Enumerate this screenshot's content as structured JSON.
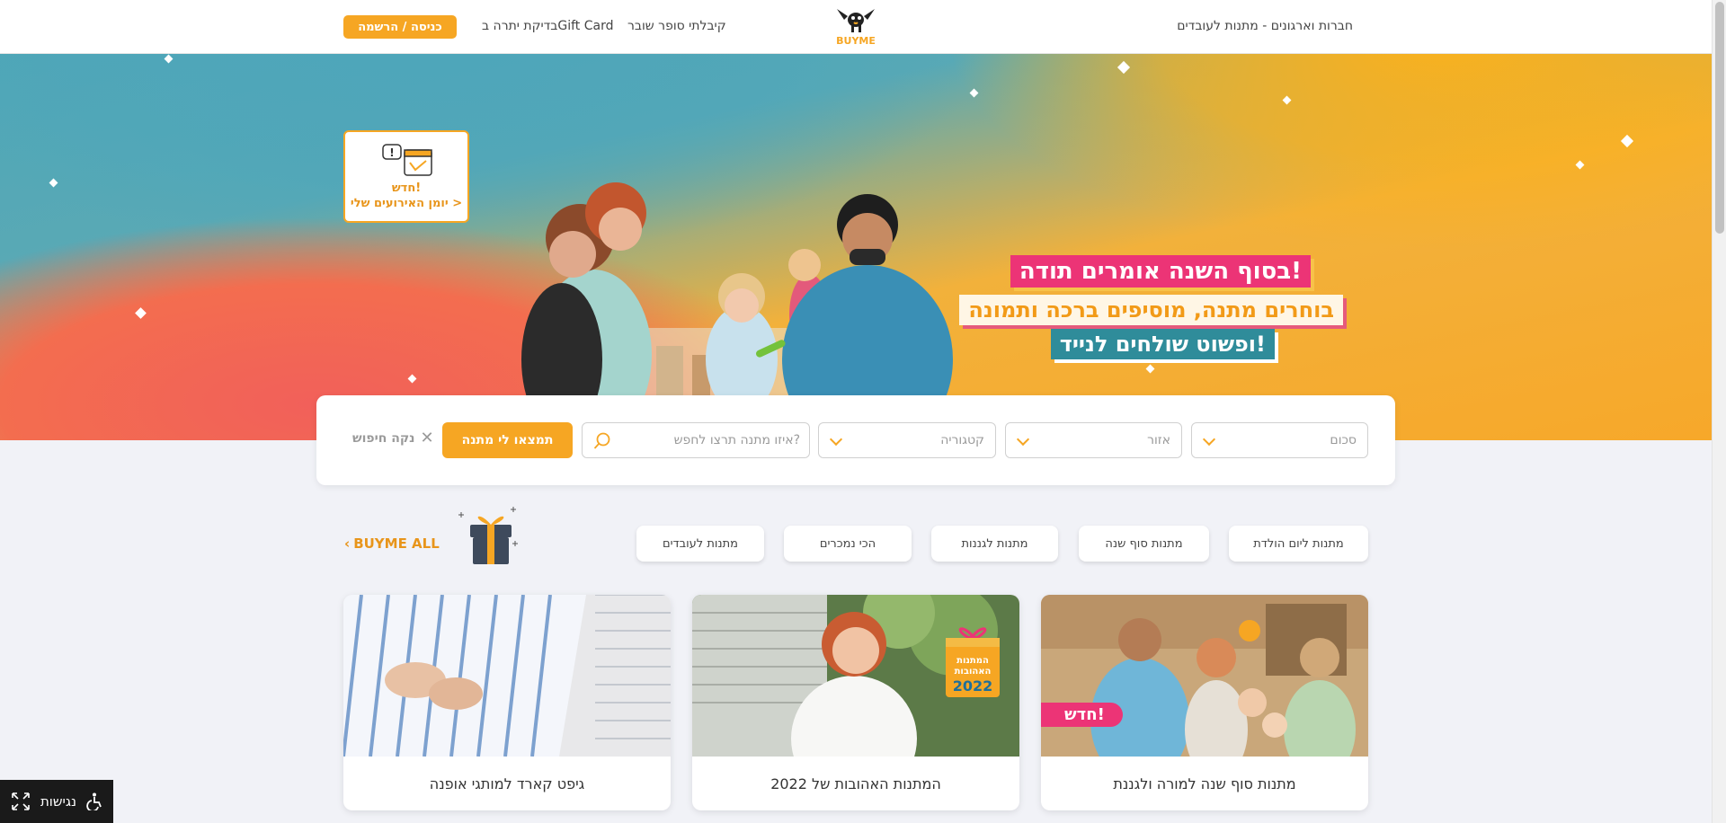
{
  "header": {
    "login_label": "כניסה / הרשמה",
    "nav_gift_card_check": "בדיקת יתרה בGift Card",
    "nav_voucher": "קיבלתי סופר שובר",
    "nav_companies": "חברות וארגונים - מתנות לעובדים",
    "logo_text": "BUYME"
  },
  "hero": {
    "calendar_new": "חדש!",
    "calendar_link": "יומן האירועים שלי >",
    "line1": "בסוף השנה אומרים תודה!",
    "line2": "בוחרים מתנה, מוסיפים ברכה ותמונה",
    "line3": "ופשוט שולחים לנייד!"
  },
  "search": {
    "sum_placeholder": "סכום",
    "area_placeholder": "אזור",
    "category_placeholder": "קטגוריה",
    "query_placeholder": "איזו מתנה תרצו לחפש?",
    "find_button": "תמצאו לי מתנה",
    "clear_label": "נקה חיפוש"
  },
  "categories": [
    {
      "label": "מתנות ליום הולדת"
    },
    {
      "label": "מתנות סוף שנה"
    },
    {
      "label": "מתנות לגננות"
    },
    {
      "label": "הכי נמכרים"
    },
    {
      "label": "מתנות לעובדים"
    }
  ],
  "buyme_all": "BUYME ALL",
  "cards": [
    {
      "title": "מתנות סוף שנה למורה ולגננת",
      "badge": "חדש!"
    },
    {
      "title": "המתנות האהובות של 2022",
      "badge_line1": "המתנות",
      "badge_line2": "האהובות",
      "badge_year": "2022"
    },
    {
      "title": "גיפט קארד למותגי אופנה"
    }
  ],
  "accessibility_label": "נגישות",
  "colors": {
    "brand_orange": "#f6a623",
    "pink": "#ec3476",
    "teal": "#2f8c9a"
  }
}
